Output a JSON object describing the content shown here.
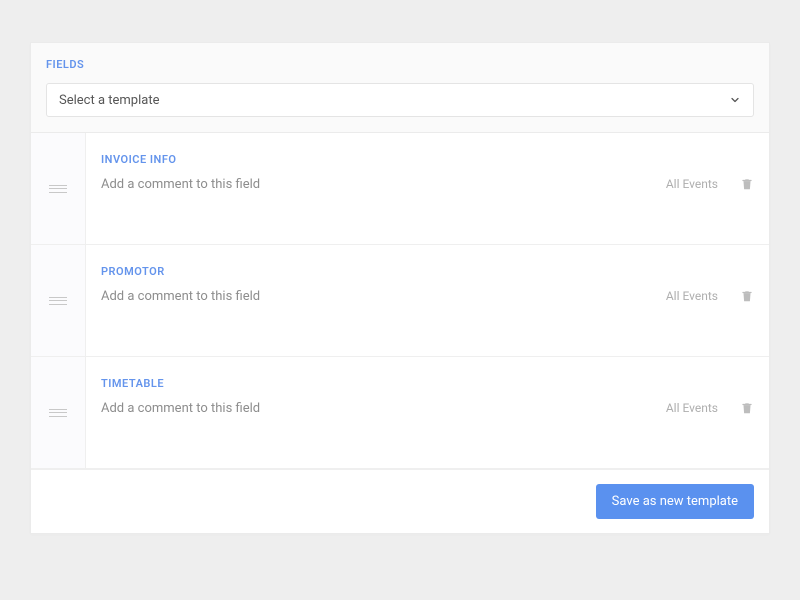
{
  "header": {
    "title": "FIELDS",
    "template_select_label": "Select a template"
  },
  "fields": [
    {
      "title": "INVOICE INFO",
      "comment_placeholder": "Add a comment to this field",
      "events_label": "All Events"
    },
    {
      "title": "PROMOTOR",
      "comment_placeholder": "Add a comment to this field",
      "events_label": "All Events"
    },
    {
      "title": "TIMETABLE",
      "comment_placeholder": "Add a comment to this field",
      "events_label": "All Events"
    }
  ],
  "footer": {
    "save_label": "Save as new template"
  }
}
